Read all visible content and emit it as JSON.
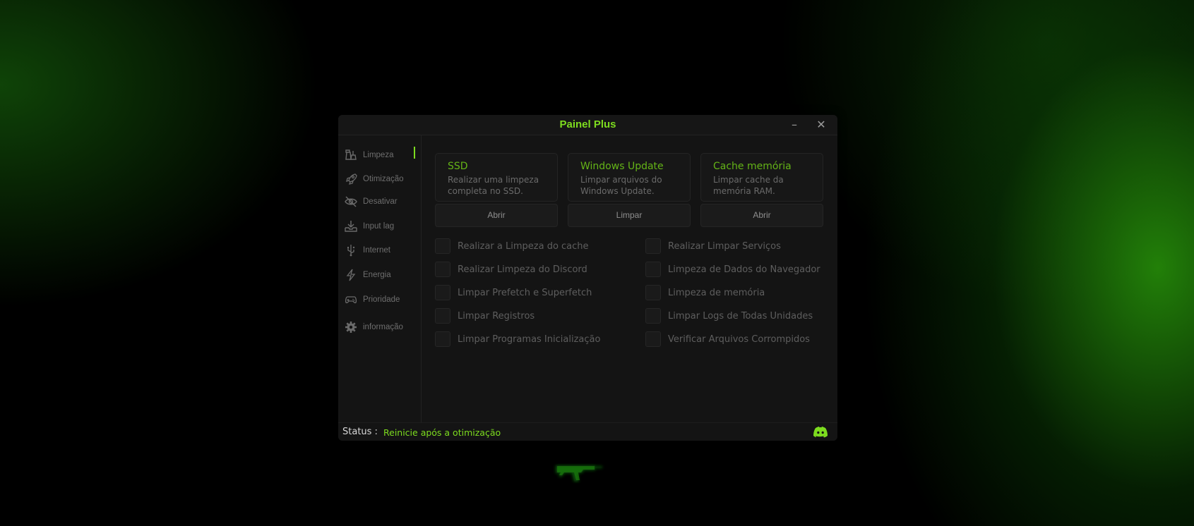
{
  "app": {
    "title": "Painel Plus"
  },
  "window_controls": {
    "minimize": "–",
    "close": "✕"
  },
  "sidebar": {
    "items": [
      {
        "label": "Limpeza",
        "icon": "broom-icon",
        "active": true
      },
      {
        "label": "Otimização",
        "icon": "rocket-icon"
      },
      {
        "label": "Desativar",
        "icon": "eye-off-icon"
      },
      {
        "label": "Input lag",
        "icon": "download-tray-icon"
      },
      {
        "label": "Internet",
        "icon": "usb-icon"
      },
      {
        "label": "Energia",
        "icon": "lightning-icon"
      },
      {
        "label": "Prioridade",
        "icon": "gamepad-icon"
      },
      {
        "label": "informação",
        "icon": "gear-icon"
      }
    ]
  },
  "cards": [
    {
      "title": "SSD",
      "desc_line1": "Realizar uma limpeza",
      "desc_line2": "completa no SSD.",
      "button": "Abrir"
    },
    {
      "title": "Windows Update",
      "desc_line1": "Limpar arquivos do",
      "desc_line2": "Windows Update.",
      "button": "Limpar"
    },
    {
      "title": "Cache memória",
      "desc_line1": "Limpar cache da",
      "desc_line2": "memória RAM.",
      "button": "Abrir"
    }
  ],
  "options": {
    "left": [
      "Realizar a Limpeza do cache",
      "Realizar Limpeza do Discord",
      "Limpar Prefetch e Superfetch",
      "Limpar Registros",
      "Limpar Programas Inicialização"
    ],
    "right": [
      "Realizar Limpar Serviços",
      "Limpeza de Dados do Navegador",
      "Limpeza de memória",
      "Limpar Logs de Todas Unidades",
      "Verificar Arquivos Corrompidos"
    ]
  },
  "status": {
    "prefix": "Status :",
    "value": "Reinicie após a otimização"
  },
  "colors": {
    "accent": "#7ddc1f",
    "card_title": "#64b417",
    "background": "#141414"
  }
}
